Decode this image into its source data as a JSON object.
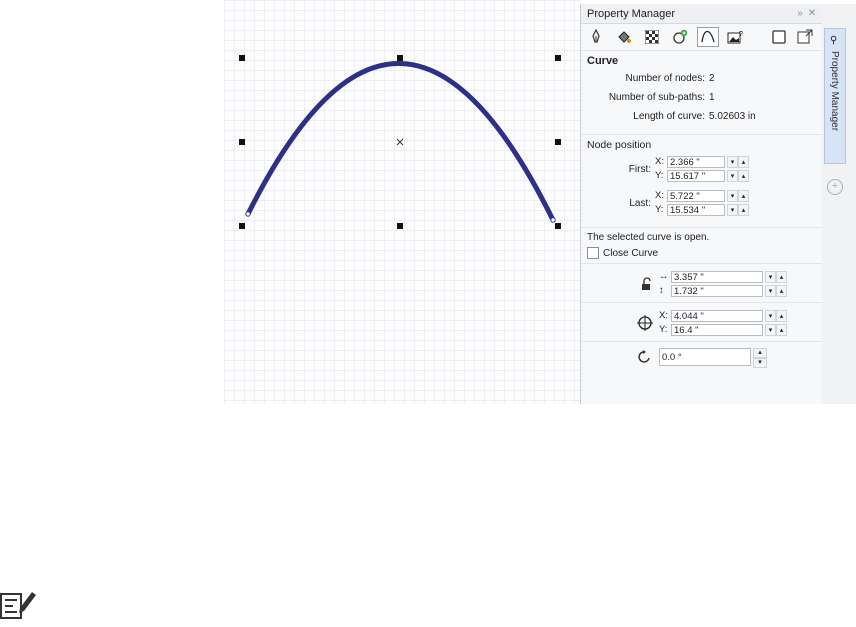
{
  "panel": {
    "title": "Property Manager",
    "title_controls": [
      "»",
      "✕"
    ],
    "toolbar_icons": [
      "pen-icon",
      "fill-icon",
      "pattern-icon",
      "add-effect-icon",
      "curve-icon",
      "bitmap-icon",
      "frame-icon",
      "export-frame-icon"
    ],
    "curve": {
      "title": "Curve",
      "nodes_label": "Number of nodes:",
      "nodes_value": "2",
      "subpaths_label": "Number of sub-paths:",
      "subpaths_value": "1",
      "length_label": "Length of curve:",
      "length_value": "5.02603 in"
    },
    "node_position": {
      "title": "Node position",
      "first_label": "First:",
      "first_x": "2.366 \"",
      "first_y": "15.617 \"",
      "last_label": "Last:",
      "last_x": "5.722 \"",
      "last_y": "15.534 \""
    },
    "open": {
      "status": "The selected curve is open.",
      "close_label": "Close Curve"
    },
    "size": {
      "width": "3.357 \"",
      "height": "1.732 \""
    },
    "position": {
      "x": "4.044 \"",
      "y": "16.4 \""
    },
    "rotation": {
      "value": "0.0 °"
    },
    "axis_x": "X:",
    "axis_y": "Y:"
  },
  "side": {
    "tab_label": "Property Manager"
  },
  "colors": {
    "curve": "#2e2f86",
    "handle": "#111111",
    "panel_bg": "#f7f8fa",
    "side_tab": "#d6e4f5"
  }
}
